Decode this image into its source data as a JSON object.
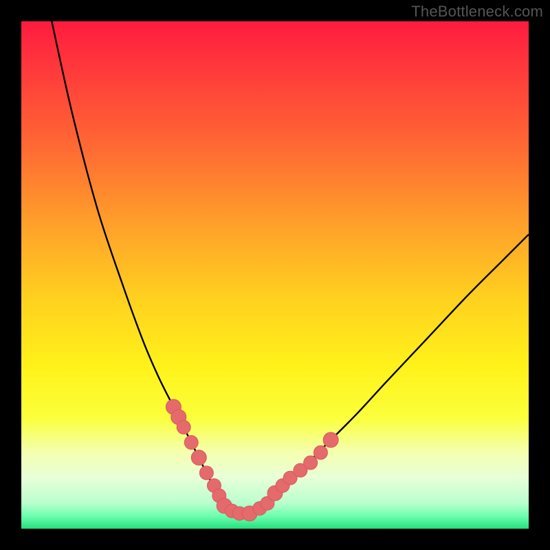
{
  "watermark": "TheBottleneck.com",
  "colors": {
    "frame": "#000000",
    "curve": "#000000",
    "marker_fill": "#e46a6c",
    "marker_stroke": "#d85a5c",
    "gradient_stops": [
      {
        "offset": 0.0,
        "color": "#ff1b3f"
      },
      {
        "offset": 0.1,
        "color": "#ff3b3b"
      },
      {
        "offset": 0.25,
        "color": "#ff6a33"
      },
      {
        "offset": 0.4,
        "color": "#ffa02a"
      },
      {
        "offset": 0.55,
        "color": "#ffd21f"
      },
      {
        "offset": 0.68,
        "color": "#fff21a"
      },
      {
        "offset": 0.78,
        "color": "#fbff3a"
      },
      {
        "offset": 0.85,
        "color": "#f4ffb0"
      },
      {
        "offset": 0.9,
        "color": "#e8ffd8"
      },
      {
        "offset": 0.95,
        "color": "#b8ffce"
      },
      {
        "offset": 0.975,
        "color": "#6effae"
      },
      {
        "offset": 1.0,
        "color": "#24e07e"
      }
    ]
  },
  "chart_data": {
    "type": "line",
    "title": "",
    "xlabel": "",
    "ylabel": "",
    "xlim": [
      0,
      100
    ],
    "ylim": [
      0,
      100
    ],
    "series": [
      {
        "name": "bottleneck-curve",
        "x": [
          6,
          10,
          15,
          20,
          24,
          27,
          30,
          32.5,
          35,
          37,
          38.5,
          40,
          42,
          44,
          46,
          50,
          55,
          60,
          66,
          72,
          80,
          88,
          95,
          100
        ],
        "values": [
          100,
          82,
          63,
          48,
          37,
          30,
          24,
          19,
          14,
          10,
          7,
          4.5,
          3,
          3,
          4,
          7,
          11.5,
          16.5,
          22.5,
          29,
          37.5,
          46,
          53,
          58
        ]
      }
    ],
    "markers": {
      "name": "highlighted-points",
      "x": [
        30,
        31,
        32,
        33.5,
        35,
        36.5,
        38,
        39,
        40,
        41.5,
        43,
        45,
        47,
        48.5,
        50,
        51.5,
        53,
        55,
        57,
        59,
        61
      ],
      "values": [
        24,
        22,
        20,
        17,
        14,
        11,
        8.5,
        6.5,
        4.5,
        3.5,
        3,
        3,
        4,
        5,
        7,
        8.5,
        10,
        11.5,
        13,
        15,
        17.5
      ],
      "r": [
        11,
        11,
        10,
        10,
        11,
        10,
        10,
        10,
        11,
        10,
        10,
        11,
        10,
        10,
        11,
        10,
        10,
        10,
        10,
        10,
        11
      ]
    }
  }
}
